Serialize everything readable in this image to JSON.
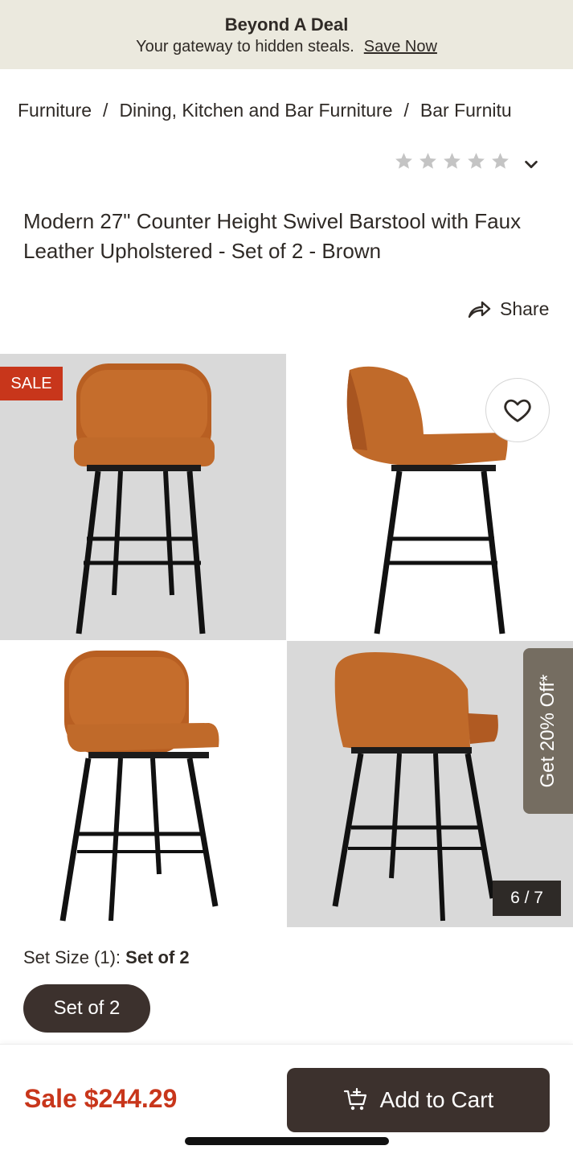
{
  "promo_banner": {
    "title": "Beyond A Deal",
    "subtitle": "Your gateway to hidden steals.",
    "link": "Save Now"
  },
  "breadcrumb": {
    "items": [
      "Furniture",
      "Dining, Kitchen and Bar Furniture",
      "Bar Furnitu"
    ],
    "separator": "/"
  },
  "rating": {
    "stars_total": 5,
    "stars_filled": 0,
    "icon": "star-icon",
    "expand_icon": "chevron-down-icon"
  },
  "product": {
    "title": "Modern 27\" Counter Height Swivel Barstool with Faux Leather Upholstered - Set of 2 - Brown"
  },
  "share": {
    "label": "Share",
    "icon": "share-arrow-icon"
  },
  "gallery": {
    "sale_badge": "SALE",
    "counter": "6 / 7",
    "favorite_icon": "heart-icon",
    "images": [
      "barstool-front",
      "barstool-side",
      "barstool-angle-left",
      "barstool-back-angle"
    ]
  },
  "side_promo": {
    "label": "Get 20% Off*"
  },
  "options": {
    "set_size_label": "Set Size (1): ",
    "set_size_value": "Set of 2",
    "selected_option": "Set of 2"
  },
  "purchase": {
    "price_text": "Sale $244.29",
    "add_to_cart_label": "Add to Cart",
    "cart_icon": "cart-plus-icon"
  },
  "colors": {
    "promo_bg": "#ebe9de",
    "sale_red": "#c8361b",
    "dark_brown": "#3c312d",
    "promo_tab": "#756d61",
    "leather": "#c06a2a"
  }
}
